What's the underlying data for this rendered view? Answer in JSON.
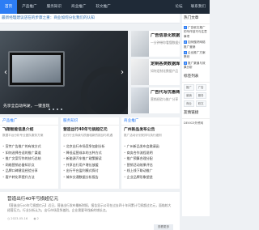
{
  "nav": {
    "items": [
      "首页",
      "产品推广",
      "服务知识",
      "商业推广",
      "软文推广"
    ],
    "right_items": [
      "论坛",
      "联系我们"
    ]
  },
  "ticker": {
    "text": "最新经理建议店在的步骤之重：商业如何分化我们的认知"
  },
  "hero": {
    "caption": "先享全自动驾驶，一键呈现"
  },
  "featured": [
    {
      "title": "广告信息化数据运营",
      "sub": "一分钟带你看懂数据分析"
    },
    {
      "title": "定制各类数据库数据",
      "sub": "如何定制化数据产品"
    },
    {
      "title": "广告代写优惠商用通",
      "sub": "营销经验与推广分享"
    }
  ],
  "columns": [
    {
      "head": "产品推广",
      "title": "飞翔智能信息介绍",
      "sub": "数据平台分析专业团队服务方案",
      "list": [
        "宣传广告推广的有效方式",
        "如何选择合适的推广渠道",
        "推广文案写作的技巧总结",
        "网络营销必备知识点",
        "品牌口碑建设经验分享",
        "客户转化率提升方法"
      ]
    },
    {
      "head": "服务知识",
      "title": "营造出行40年亏损超亿元",
      "sub": "出行行业持续亏损面临新的挑战与机遇",
      "list": [
        "北京出行市场竞争加剧分析",
        "降低运营成本的五种方式",
        "新能源汽车推广政策解读",
        "共享出行用户增长放缓",
        "出行平台盈利模式探讨",
        "城市交通数据分析报告"
      ]
    },
    {
      "head": "商业推广",
      "title": "广州新品发布公告",
      "sub": "推广活动计划安排与执行细则",
      "list": [
        "广州新品发布会邀请函",
        "商务合作流程说明",
        "推广预算合理分配",
        "营销活动效果评估",
        "线上线下联动推广",
        "企业品牌形象塑造"
      ]
    }
  ],
  "article": {
    "title": "营造出行40年亏损超亿元",
    "body": "【营造出行40年亏损超亿元】近日，营造出行发布最新财报，报告显示公司在过去四十年间累计亏损超过亿元，面临较大经营压力。行业分析认为，出行市场竞争激烈，企业需要寻找新的增长点。",
    "date": "2023-05-16",
    "views": "2",
    "more_label": "查看更多"
  },
  "sidebar": {
    "hot_head": "热门文章",
    "hot_list": [
      "广告软文推广的写作技巧与注意事项",
      "如何做好网络推广营销",
      "企业推广方案策划",
      "推广渠道与效果分析"
    ],
    "tags_head": "标签列表",
    "tags": [
      "推广",
      "广告",
      "营销",
      "服务",
      "商业",
      "软文"
    ],
    "friend_head": "友情链接",
    "friend_link": "DEVICE外贸网"
  }
}
